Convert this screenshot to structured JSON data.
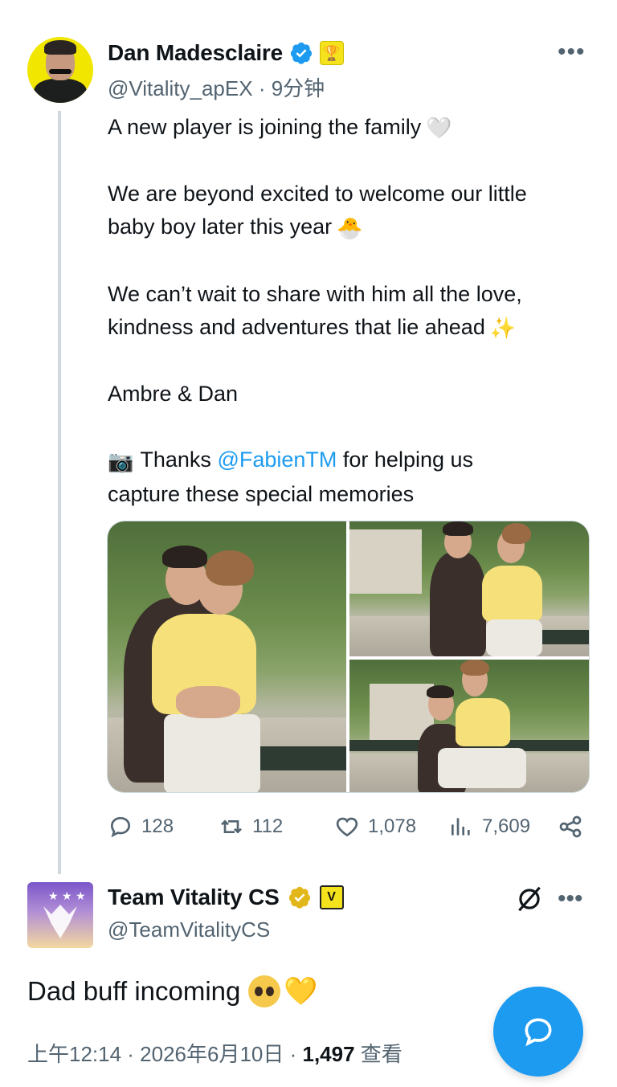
{
  "tweet": {
    "author_name": "Dan Madesclaire",
    "handle": "@Vitality_apEX",
    "time_ago": "9分钟",
    "more_label": "•••",
    "lines": [
      "A new player is joining the family",
      "We are beyond excited to welcome our little",
      "baby boy later this year",
      "We can’t wait to share with him all the love,",
      "kindness and adventures that lie ahead",
      "Ambre & Dan",
      "Thanks",
      "@FabienTM",
      "for helping us",
      "capture these special memories"
    ],
    "emojis": {
      "heart": "🤍",
      "chick": "🐣",
      "sparkles": "✨",
      "camera": "📷"
    },
    "stats": {
      "replies": "128",
      "retweets": "112",
      "likes": "1,078",
      "views": "7,609"
    }
  },
  "reply": {
    "author_name": "Team Vitality CS",
    "handle": "@TeamVitalityCS",
    "text": "Dad buff incoming",
    "heart_emoji": "💛",
    "timestamp": "上午12:14 · 2026年6月10日 · ",
    "views_count": "1,497",
    "views_label": " 查看",
    "more_label": "•••"
  },
  "colors": {
    "accent": "#1d9bf0",
    "secondary_text": "#536471",
    "verified_gold": "#e2b719"
  },
  "icons": [
    "reply-icon",
    "retweet-icon",
    "like-icon",
    "views-icon",
    "share-icon",
    "grok-icon",
    "compose-icon",
    "verified-icon",
    "gold-verified-icon"
  ]
}
